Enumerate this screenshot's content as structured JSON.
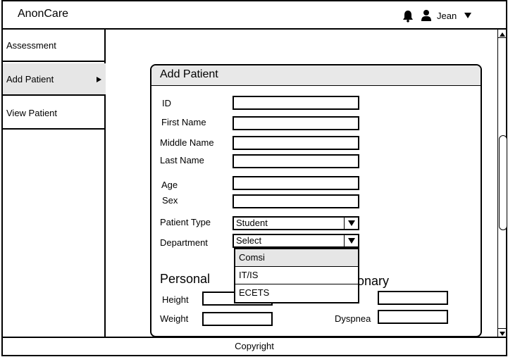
{
  "app": {
    "title": "AnonCare"
  },
  "header": {
    "user_name": "Jean"
  },
  "sidebar": {
    "items": [
      {
        "label": "Assessment"
      },
      {
        "label": "Add Patient"
      },
      {
        "label": "View Patient"
      }
    ]
  },
  "card": {
    "title": "Add Patient",
    "fields": {
      "id": "ID",
      "first_name": "First Name",
      "middle_name": "Middle Name",
      "last_name": "Last Name",
      "age": "Age",
      "sex": "Sex",
      "patient_type": "Patient Type",
      "department": "Department"
    },
    "patient_type_value": "Student",
    "department_value": "Select",
    "department_options": [
      "Comsi",
      "IT/IS",
      "ECETS"
    ],
    "personal_title": "Personal",
    "pulmonary_title_visible": "onary",
    "height_label": "Height",
    "weight_label": "Weight",
    "dyspnea_label": "Dyspnea"
  },
  "footer": {
    "text": "Copyright"
  }
}
